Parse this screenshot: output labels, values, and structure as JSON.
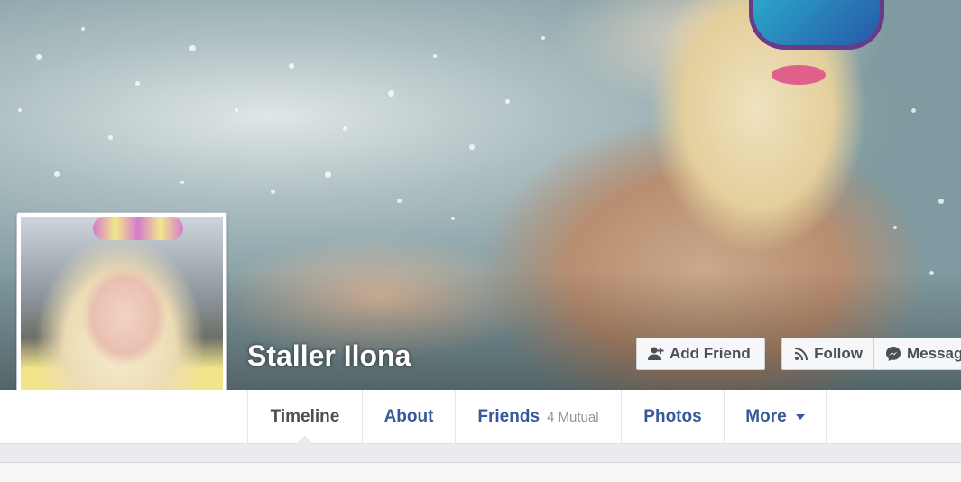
{
  "profile": {
    "name": "Staller Ilona"
  },
  "actions": {
    "add_friend": "Add Friend",
    "follow": "Follow",
    "message": "Message"
  },
  "tabs": [
    {
      "label": "Timeline",
      "active": true
    },
    {
      "label": "About"
    },
    {
      "label": "Friends",
      "sub": "4 Mutual"
    },
    {
      "label": "Photos"
    },
    {
      "label": "More",
      "dropdown": true
    }
  ],
  "colors": {
    "link": "#365899",
    "active_tab": "#4b4f56",
    "page_bg": "#e9ebee"
  },
  "icons": {
    "add_friend": "add-friend-icon",
    "follow": "rss-icon",
    "message": "messenger-icon",
    "more": "caret-down-icon"
  }
}
